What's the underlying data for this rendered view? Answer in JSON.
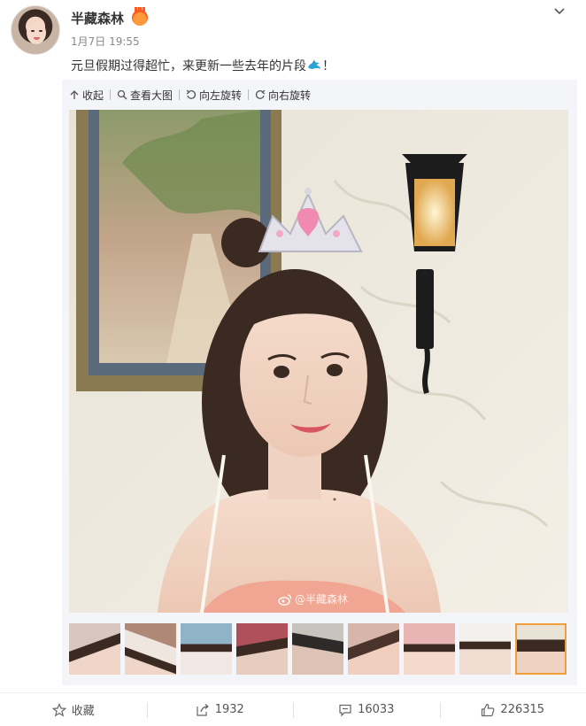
{
  "post": {
    "username": "半藏森林",
    "timestamp": "1月7日 19:55",
    "text_before": "元旦假期过得超忙，来更新一些去年的片段",
    "text_after": "！"
  },
  "toolbar": {
    "collapse": "收起",
    "view_large": "查看大图",
    "rotate_left": "向左旋转",
    "rotate_right": "向右旋转"
  },
  "watermark": "@半藏森林",
  "thumbnails": {
    "count": 9,
    "active_index": 8
  },
  "actions": {
    "favorite": "收藏",
    "repost": "1932",
    "comment": "16033",
    "like": "226315"
  },
  "colors": {
    "accent": "#f29c3c",
    "media_background": "#f4f5f8",
    "meta_text": "#888888"
  },
  "icons": [
    "avatar",
    "vip-icon",
    "chevron-down-icon",
    "dolphin-emoji-icon",
    "collapse-icon",
    "magnifier-icon",
    "rotate-left-icon",
    "rotate-right-icon",
    "weibo-logo-icon",
    "star-icon",
    "share-icon",
    "comment-icon",
    "thumbs-up-icon"
  ]
}
